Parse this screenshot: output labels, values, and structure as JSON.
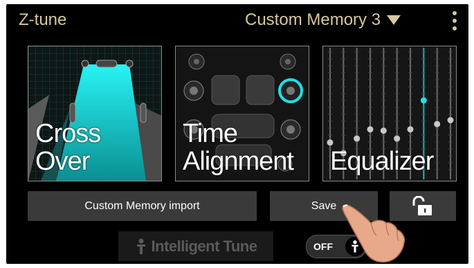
{
  "header": {
    "app_title": "Z-tune",
    "memory_selection": "Custom Memory 3",
    "dropdown_icon": "triangle-down-icon",
    "menu_icon": "kebab-menu-icon"
  },
  "tiles": {
    "crossover": {
      "line1": "Cross",
      "line2": "Over"
    },
    "time_alignment": {
      "line1": "Time",
      "line2": "Alignment"
    },
    "equalizer": {
      "line1": "",
      "line2": "Equalizer"
    }
  },
  "actions": {
    "import_label": "Custom Memory import",
    "save_label": "Save",
    "lock_icon": "unlock-icon"
  },
  "intelligent_tune": {
    "label": "Intelligent Tune",
    "toggle_label": "OFF",
    "toggle_state": "off"
  },
  "colors": {
    "header_text": "#d8c79b",
    "accent_cyan": "#1de1e6",
    "background": "#000000",
    "button_bg": "#3a3a3a"
  },
  "equalizer_levels": [
    0.28,
    0.2,
    0.31,
    0.38,
    0.37,
    0.31,
    0.38,
    0.6,
    0.42,
    0.45
  ]
}
